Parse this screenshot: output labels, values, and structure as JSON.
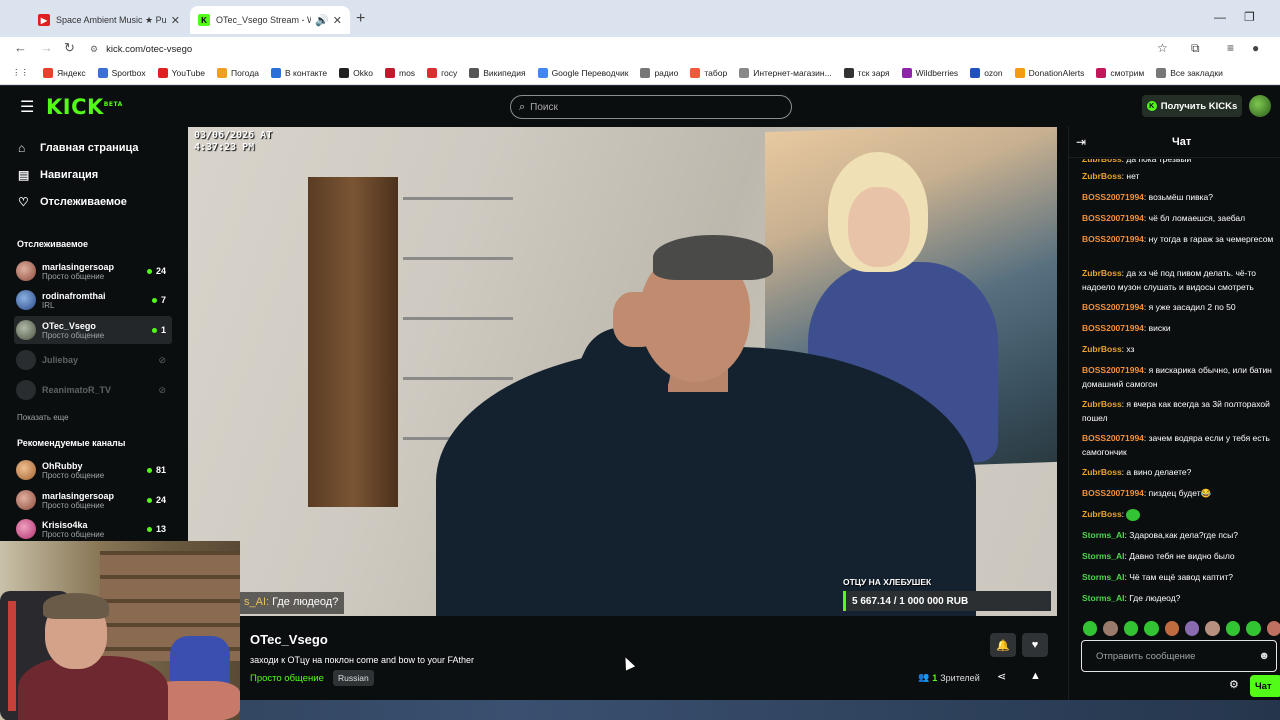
{
  "browser": {
    "tabs": [
      {
        "title": "Space Ambient Music ★ Pure (",
        "active": false
      },
      {
        "title": "OTec_Vsego Stream - Watch",
        "active": true
      }
    ],
    "url": "kick.com/otec-vsego",
    "bookmarks": [
      "Яндекс",
      "Sportbox",
      "YouTube",
      "Погода",
      "В контакте",
      "Okko",
      "mos",
      "госу",
      "Википедия",
      "Google Переводчик",
      "радио",
      "табор",
      "Интернет-магазин...",
      "тск заря",
      "Wildberries",
      "ozon",
      "DonationAlerts",
      "смотрим",
      "Все закладки"
    ],
    "bookmark_colors": [
      "#e8402a",
      "#3a6fd8",
      "#e02020",
      "#f0a020",
      "#2a70d8",
      "#222222",
      "#c0182c",
      "#d83030",
      "#555555",
      "#4285f4",
      "#777777",
      "#f05a3a",
      "#888888",
      "#333333",
      "#8e24aa",
      "#2050c0",
      "#f39c12",
      "#c2185b",
      "#777777"
    ]
  },
  "kick": {
    "logo": "KICK",
    "logo_badge": "BETA",
    "search_placeholder": "Поиск",
    "get_kicks": "Получить KICKs"
  },
  "sidebar": {
    "nav": [
      {
        "label": "Главная страница",
        "icon": "home-icon"
      },
      {
        "label": "Навигация",
        "icon": "browse-icon"
      },
      {
        "label": "Отслеживаемое",
        "icon": "heart-icon"
      }
    ],
    "following_title": "Отслеживаемое",
    "following": [
      {
        "name": "marlasingersoap",
        "category": "Просто общение",
        "viewers": "24",
        "live": true
      },
      {
        "name": "rodinafromthai",
        "category": "IRL",
        "viewers": "7",
        "live": true
      },
      {
        "name": "OTec_Vsego",
        "category": "Просто общение",
        "viewers": "1",
        "live": true
      },
      {
        "name": "Juliebay",
        "category": "",
        "viewers": "",
        "live": false
      },
      {
        "name": "ReanimatoR_TV",
        "category": "",
        "viewers": "",
        "live": false
      }
    ],
    "show_more": "Показать еще",
    "recommended_title": "Рекомендуемые каналы",
    "recommended": [
      {
        "name": "OhRubby",
        "category": "Просто общение",
        "viewers": "81"
      },
      {
        "name": "marlasingersoap",
        "category": "Просто общение",
        "viewers": "24"
      },
      {
        "name": "Krisiso4ka",
        "category": "Просто общение",
        "viewers": "13"
      }
    ]
  },
  "video": {
    "timestamp_line1": "03/06/2026 AT",
    "timestamp_line2": "4:37:23 PM",
    "overlay_user": "s_AI:",
    "overlay_text": "Где людеод?",
    "goal_title": "ОТЦУ НА ХЛЕБУШЕК",
    "goal_value": "5 667.14 / 1 000 000 RUB",
    "goal_progress": 0.0057
  },
  "stream": {
    "name": "OTec_Vsego",
    "title": "заходи к ОТцу на поклон come and bow to your FAther",
    "category": "Просто общение",
    "language": "Russian",
    "viewers_count": "1",
    "viewers_label": "Зрителей"
  },
  "chat": {
    "title": "Чат",
    "messages": [
      {
        "user": "ZubrBoss",
        "text": "да пока трезвый",
        "style": "zb"
      },
      {
        "user": "ZubrBoss",
        "text": "нет",
        "style": "zb"
      },
      {
        "user": "BOSS20071994",
        "text": "возьмёш пивка?",
        "style": "bs"
      },
      {
        "user": "BOSS20071994",
        "text": "чё бл ломаешся, заебал",
        "style": "bs"
      },
      {
        "user": "BOSS20071994",
        "text": "ну тогда в гараж за чемергесом",
        "style": "bs"
      },
      {
        "user": "ZubrBoss",
        "text": "да хз чё под пивом делать. чё-то надоело музон слушать и видосы смотреть",
        "style": "zb"
      },
      {
        "user": "BOSS20071994",
        "text": "я уже засадил 2 по 50",
        "style": "bs"
      },
      {
        "user": "BOSS20071994",
        "text": "виски",
        "style": "bs"
      },
      {
        "user": "ZubrBoss",
        "text": "хз",
        "style": "zb"
      },
      {
        "user": "BOSS20071994",
        "text": "я вискарика обычно, или батин домашний самогон",
        "style": "bs"
      },
      {
        "user": "ZubrBoss",
        "text": "я вчера как всегда за 3й полторахой пошел",
        "style": "zb"
      },
      {
        "user": "BOSS20071994",
        "text": "зачем водяра если у тебя есть самогончик",
        "style": "bs"
      },
      {
        "user": "ZubrBoss",
        "text": "а вино делаете?",
        "style": "zb"
      },
      {
        "user": "BOSS20071994",
        "text": "пиздец будет😂",
        "style": "bs"
      },
      {
        "user": "ZubrBoss",
        "text": "",
        "style": "zb"
      },
      {
        "user": "Storms_AI",
        "text": "Здарова,как дела?где псы?",
        "style": "st"
      },
      {
        "user": "Storms_AI",
        "text": "Давно тебя не видно было",
        "style": "st"
      },
      {
        "user": "Storms_AI",
        "text": "Чё там ещё завод каптит?",
        "style": "st"
      },
      {
        "user": "Storms_AI",
        "text": "Где людеод?",
        "style": "st"
      }
    ],
    "emote_colors": [
      "#33c433",
      "#9a7a6a",
      "#33c433",
      "#33c433",
      "#c06a40",
      "#8a6ab0",
      "#b89080",
      "#33c433",
      "#33c433",
      "#c07060"
    ],
    "input_placeholder": "Отправить сообщение",
    "send_label": "Чат"
  }
}
